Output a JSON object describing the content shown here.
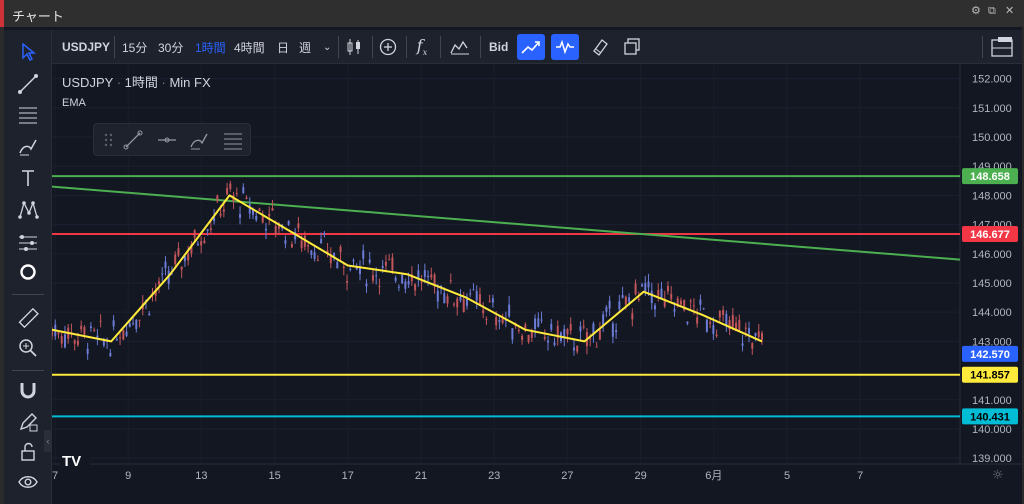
{
  "window": {
    "title": "チャート"
  },
  "toolbar": {
    "symbol": "USDJPY",
    "intervals": [
      "15分",
      "30分",
      "1時間",
      "4時間",
      "日",
      "週"
    ],
    "active_interval": "1時間",
    "bid_label": "Bid"
  },
  "legend": {
    "symbol": "USDJPY",
    "interval": "1時間",
    "source": "Min FX",
    "indicator": "EMA"
  },
  "price_axis": {
    "ticks": [
      "152.000",
      "151.000",
      "150.000",
      "149.000",
      "148.000",
      "147.000",
      "146.000",
      "145.000",
      "144.000",
      "143.000",
      "141.000",
      "140.000",
      "139.000"
    ]
  },
  "time_axis": {
    "ticks": [
      "7",
      "9",
      "13",
      "15",
      "17",
      "21",
      "23",
      "27",
      "29",
      "6月",
      "5",
      "7"
    ]
  },
  "price_labels": [
    {
      "value": "148.658",
      "color": "#4caf50",
      "text_color": "#ffffff"
    },
    {
      "value": "146.677",
      "color": "#f23645",
      "text_color": "#ffffff"
    },
    {
      "value": "142.570",
      "color": "#2962ff",
      "text_color": "#ffffff"
    },
    {
      "value": "141.857",
      "color": "#ffeb3b",
      "text_color": "#000000"
    },
    {
      "value": "140.431",
      "color": "#00bcd4",
      "text_color": "#000000"
    }
  ],
  "chart_data": {
    "type": "line",
    "title": "",
    "xlabel": "",
    "ylabel": "",
    "ylim": [
      138.8,
      152.5
    ],
    "x": [
      "7",
      "9",
      "13",
      "15",
      "17",
      "21",
      "23",
      "27",
      "29",
      "6月",
      "5",
      "7"
    ],
    "series": [
      {
        "values": [
          143.4,
          143.0,
          145.3,
          148.0,
          146.8,
          145.6,
          145.3,
          144.5,
          143.4,
          143.0,
          144.7,
          143.9,
          143.0
        ]
      }
    ],
    "horizontal_lines": [
      {
        "value": 148.658,
        "color": "#4caf50"
      },
      {
        "value": 146.677,
        "color": "#f23645"
      },
      {
        "value": 141.857,
        "color": "#ffeb3b"
      },
      {
        "value": 140.431,
        "color": "#00bcd4"
      }
    ],
    "trendline": {
      "from": 148.3,
      "to": 145.8,
      "color": "#4caf50"
    },
    "last_price": 142.57,
    "colors": {
      "ema": "#ffeb3b",
      "up": "#6b7bd6",
      "down": "#c2565a"
    }
  }
}
